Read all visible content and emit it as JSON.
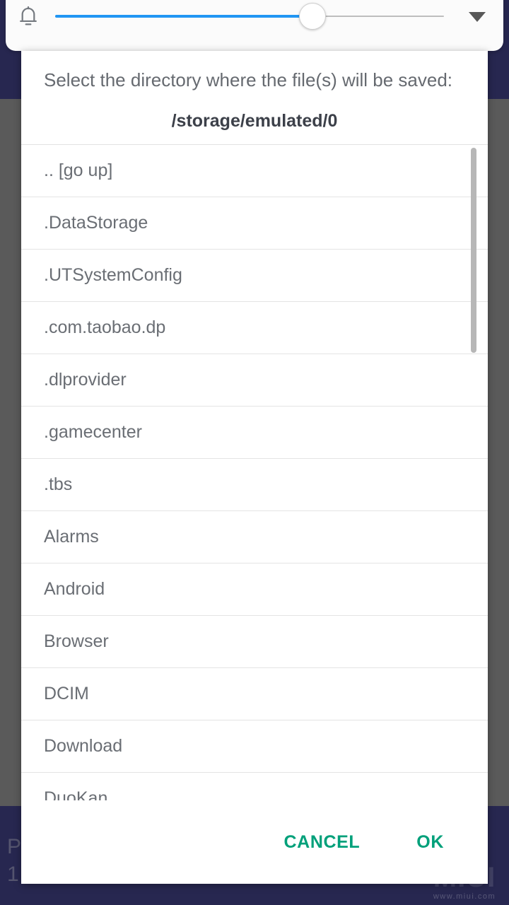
{
  "theme": {
    "background_navy": "#272750",
    "background_gray": "#5a5a5a",
    "dialog_bg": "#ffffff",
    "accent_button": "#00a07a",
    "slider_fill": "#2196f3",
    "slider_track": "#bdbdbd",
    "divider": "#e4e4e4",
    "list_text": "#6a6e74"
  },
  "volume_panel": {
    "bell_icon": "bell-icon",
    "expand_icon": "chevron-down-icon",
    "slider": {
      "value_percent": 66,
      "min": 0,
      "max": 100
    }
  },
  "dialog": {
    "title": "Select the directory where the file(s) will be saved:",
    "current_path": "/storage/emulated/0",
    "entries": [
      {
        "label": ".. [go up]"
      },
      {
        "label": ".DataStorage"
      },
      {
        "label": ".UTSystemConfig"
      },
      {
        "label": ".com.taobao.dp"
      },
      {
        "label": ".dlprovider"
      },
      {
        "label": ".gamecenter"
      },
      {
        "label": ".tbs"
      },
      {
        "label": "Alarms"
      },
      {
        "label": "Android"
      },
      {
        "label": "Browser"
      },
      {
        "label": "DCIM"
      },
      {
        "label": "Download"
      },
      {
        "label": "DuoKan"
      }
    ],
    "actions": {
      "cancel_label": "CANCEL",
      "ok_label": "OK"
    }
  },
  "background_text": {
    "fragment_letter": "P",
    "fragment_number": "1"
  },
  "watermark": {
    "logo": "MIUI",
    "url": "www.miui.com"
  }
}
